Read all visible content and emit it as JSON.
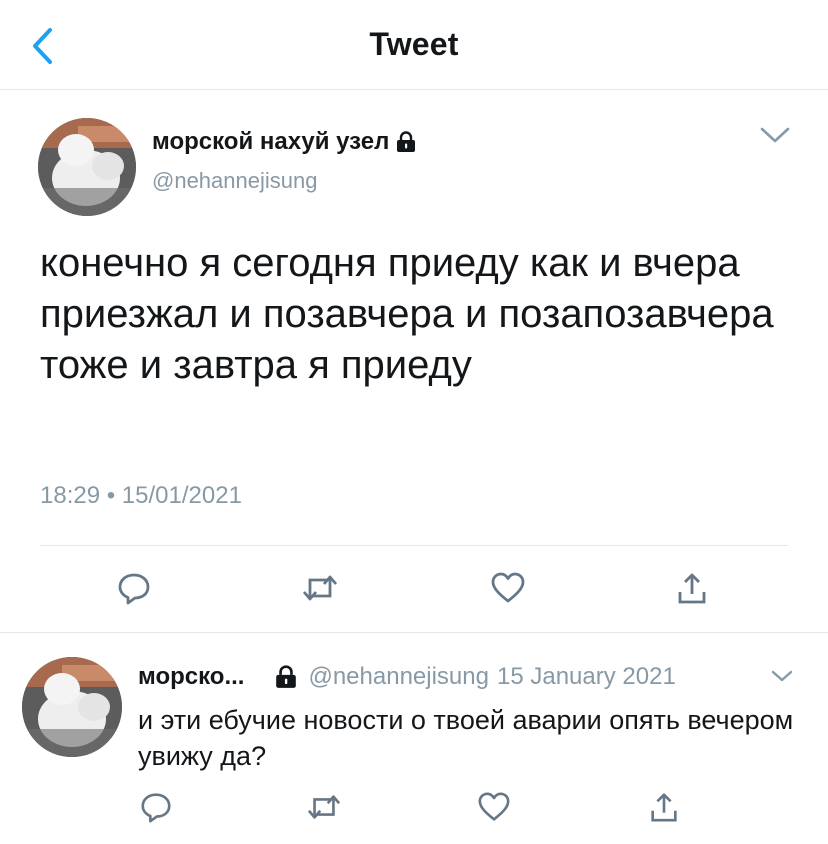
{
  "header": {
    "title": "Tweet",
    "back_icon": "chevron-left-icon",
    "accent_color": "#1da1f2"
  },
  "main_tweet": {
    "display_name": "морской нахуй узел",
    "handle": "@nehannejisung",
    "text": "конечно я сегодня приеду как и вчера приезжал и позавчера и позапозавчера тоже и завтра я приеду",
    "time": "18:29 • 15/01/2021",
    "protected": true,
    "actions": [
      "reply-icon",
      "retweet-icon",
      "like-icon",
      "share-icon"
    ]
  },
  "reply": {
    "display_name": "морско...",
    "handle": "@nehannejisung",
    "date": "15 January 2021",
    "text": "и эти ебучие новости о твоей аварии опять вечером увижу да?",
    "protected": true,
    "actions": [
      "reply-icon",
      "retweet-icon",
      "like-icon",
      "share-icon"
    ]
  },
  "colors": {
    "text": "#14171a",
    "secondary": "#8899a6",
    "icon": "#657786",
    "divider": "#e1e8ed"
  }
}
